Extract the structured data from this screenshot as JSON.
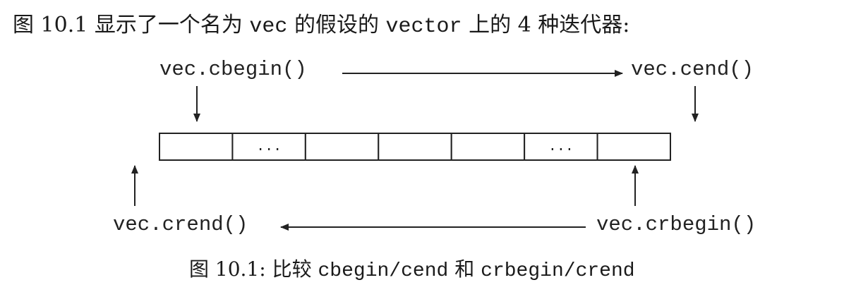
{
  "intro": {
    "prefix": "图 10.1 显示了一个名为 ",
    "vec": "vec",
    "middle": " 的假设的 ",
    "vector": "vector",
    "suffix": " 上的 4 种迭代器:"
  },
  "labels": {
    "cbegin": "vec.cbegin()",
    "cend": "vec.cend()",
    "crend": "vec.crend()",
    "crbegin": "vec.crbegin()"
  },
  "cells": [
    "",
    "...",
    "",
    "",
    "",
    "...",
    ""
  ],
  "caption": {
    "prefix": "图 10.1: 比较 ",
    "pair1": "cbegin/cend",
    "middle": " 和 ",
    "pair2": "crbegin/crend"
  }
}
